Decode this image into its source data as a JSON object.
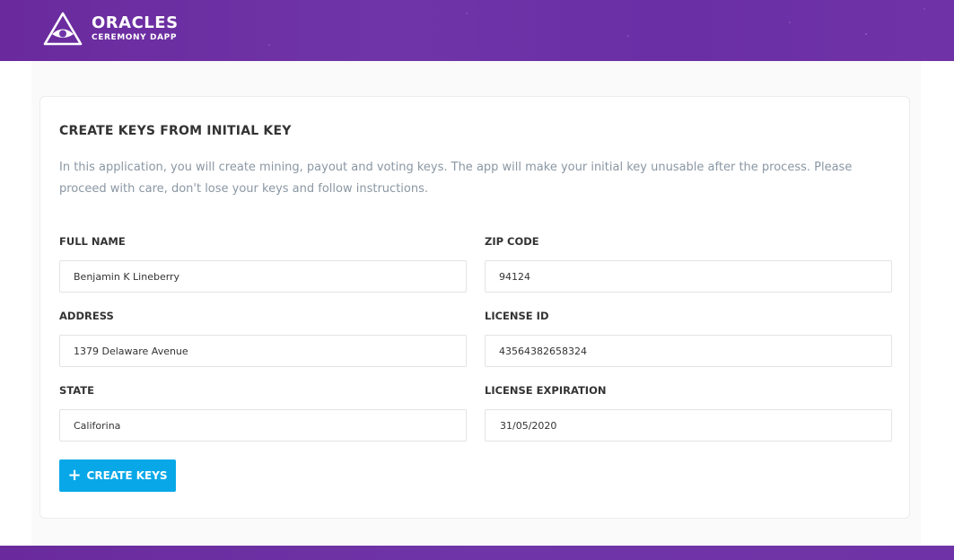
{
  "header": {
    "title": "ORACLES",
    "subtitle": "CEREMONY DAPP",
    "logo_icon": "eye-triangle-icon",
    "color": "#6f35a8"
  },
  "form": {
    "title": "CREATE KEYS FROM INITIAL KEY",
    "description": "In this application, you will create mining, payout and voting keys. The app will make your initial key unusable after the process. Please proceed with care, don't lose your keys and follow instructions.",
    "fields": {
      "full_name": {
        "label": "FULL NAME",
        "value": "Benjamin K Lineberry"
      },
      "zip_code": {
        "label": "ZIP CODE",
        "value": "94124"
      },
      "address": {
        "label": "ADDRESS",
        "value": "1379 Delaware Avenue"
      },
      "license_id": {
        "label": "LICENSE ID",
        "value": "43564382658324"
      },
      "state": {
        "label": "STATE",
        "value": "Califorina"
      },
      "license_expiration": {
        "label": "LICENSE EXPIRATION",
        "value": "31/05/2020"
      }
    },
    "submit": {
      "icon": "plus-icon",
      "label": "CREATE KEYS",
      "color": "#08a8e8"
    }
  }
}
